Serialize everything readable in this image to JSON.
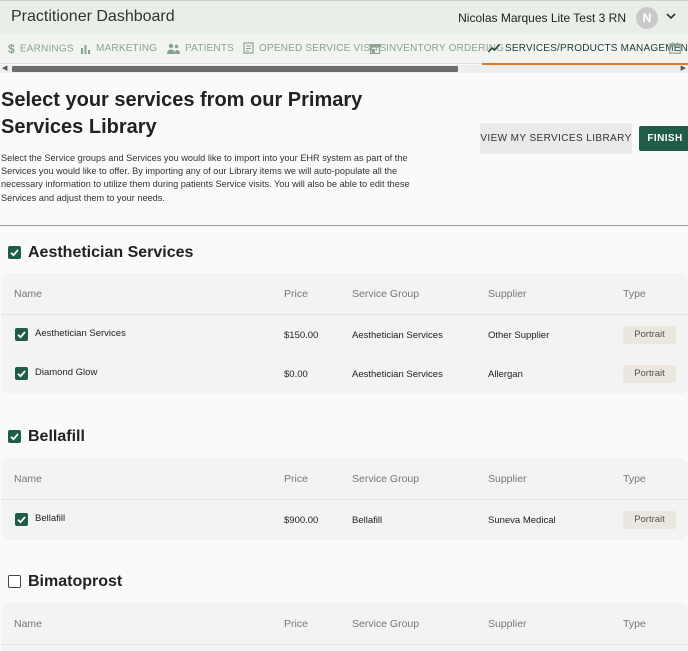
{
  "header": {
    "app_title": "Practitioner Dashboard",
    "user_name": "Nicolas Marques Lite Test 3 RN",
    "avatar_initial": "N"
  },
  "tabs": [
    {
      "label": "EARNINGS",
      "icon": "dollar-icon"
    },
    {
      "label": "MARKETING",
      "icon": "bar-chart-icon"
    },
    {
      "label": "PATIENTS",
      "icon": "people-icon"
    },
    {
      "label": "OPENED SERVICE VISITS",
      "icon": "clipboard-icon"
    },
    {
      "label": "INVENTORY ORDERING",
      "icon": "store-icon"
    },
    {
      "label": "SERVICES/PRODUCTS MANAGEMENT",
      "icon": "trend-line-icon",
      "active": true
    },
    {
      "label": "",
      "icon": "calendar-icon"
    }
  ],
  "page": {
    "heading": "Select your services from our Primary Services Library",
    "description": "Select the Service groups and Services you would like to import into your EHR system as part of the Services you would like to offer. By importing any of our Library items we will auto-populate all the necessary information to utilize them during patients Service visits. You will also be able to edit these Services and adjust them to your needs.",
    "view_library_label": "VIEW MY SERVICES LIBRARY",
    "finish_label": "FINISH"
  },
  "columns": [
    "Name",
    "Price",
    "Service Group",
    "Supplier",
    "Type"
  ],
  "groups": [
    {
      "title": "Aesthetician Services",
      "checked": true,
      "rows": [
        {
          "name": "Aesthetician Services",
          "price": "$150.00",
          "service_group": "Aesthetician Services",
          "supplier": "Other Supplier",
          "type": "Portrait",
          "checked": true
        },
        {
          "name": "Diamond Glow",
          "price": "$0.00",
          "service_group": "Aesthetician Services",
          "supplier": "Allergan",
          "type": "Portrait",
          "checked": true
        }
      ]
    },
    {
      "title": "Bellafill",
      "checked": true,
      "rows": [
        {
          "name": "Bellafill",
          "price": "$900.00",
          "service_group": "Bellafill",
          "supplier": "Suneva Medical",
          "type": "Portrait",
          "checked": true
        }
      ]
    },
    {
      "title": "Bimatoprost",
      "checked": false,
      "rows": []
    }
  ],
  "colors": {
    "accent": "#1f5c4a",
    "tab_underline": "#e07a2a",
    "tab_text": "#8aa38f"
  }
}
